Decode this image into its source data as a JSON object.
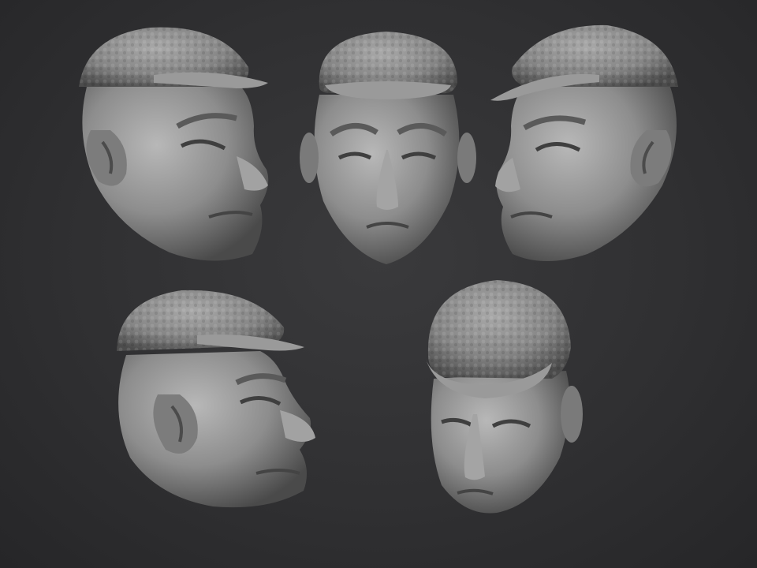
{
  "scene": {
    "background_color": "#303032",
    "sculpt_color": "#8e8e8e",
    "views": [
      {
        "name": "left-profile-upper"
      },
      {
        "name": "front-view"
      },
      {
        "name": "right-profile"
      },
      {
        "name": "left-profile-tilted"
      },
      {
        "name": "three-quarter-down"
      }
    ]
  }
}
